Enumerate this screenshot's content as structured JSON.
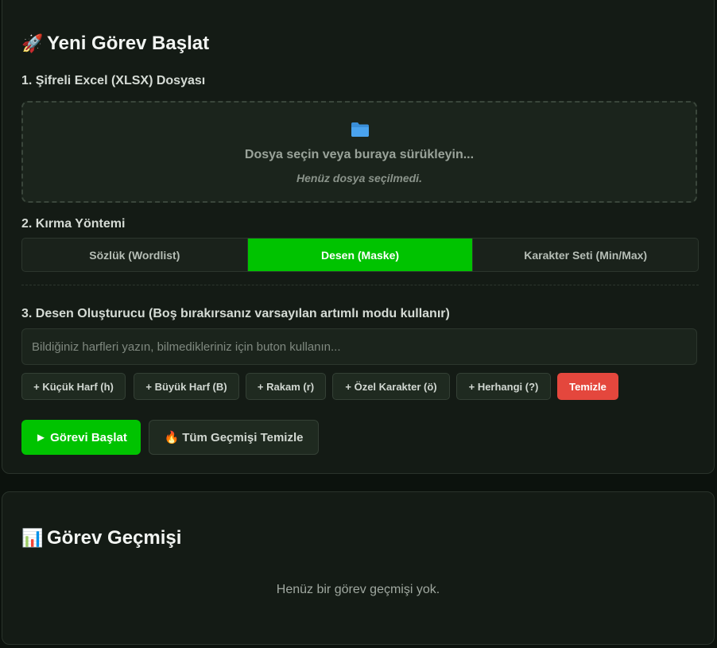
{
  "new_task": {
    "title_emoji": "🚀",
    "title": "Yeni Görev Başlat",
    "file_section": {
      "label": "1. Şifreli Excel (XLSX) Dosyası",
      "icon": "folder-icon",
      "prompt": "Dosya seçin veya buraya sürükleyin...",
      "status": "Henüz dosya seçilmedi."
    },
    "method_section": {
      "label": "2. Kırma Yöntemi",
      "options": [
        "Sözlük (Wordlist)",
        "Desen (Maske)",
        "Karakter Seti (Min/Max)"
      ],
      "selected": "Desen (Maske)"
    },
    "mask_section": {
      "label": "3. Desen Oluşturucu (Boş bırakırsanız varsayılan artımlı modu kullanır)",
      "input_value": "",
      "input_placeholder": "Bildiğiniz harfleri yazın, bilmedikleriniz için buton kullanın...",
      "chips": {
        "lower": "+ Küçük Harf (h)",
        "upper": "+ Büyük Harf (B)",
        "digit": "+ Rakam (r)",
        "special": "+ Özel Karakter (ö)",
        "any": "+ Herhangi (?)",
        "clear": "Temizle"
      }
    },
    "actions": {
      "start": "► Görevi Başlat",
      "clear_history_emoji": "🔥",
      "clear_history": "Tüm Geçmişi Temizle"
    }
  },
  "history": {
    "title_emoji": "📊",
    "title": "Görev Geçmişi",
    "empty_text": "Henüz bir görev geçmişi yok."
  },
  "colors": {
    "accent": "#00c300",
    "danger": "#e4473d",
    "folder": "#3a8fd9",
    "background": "#0c120d",
    "card": "#141b15"
  }
}
